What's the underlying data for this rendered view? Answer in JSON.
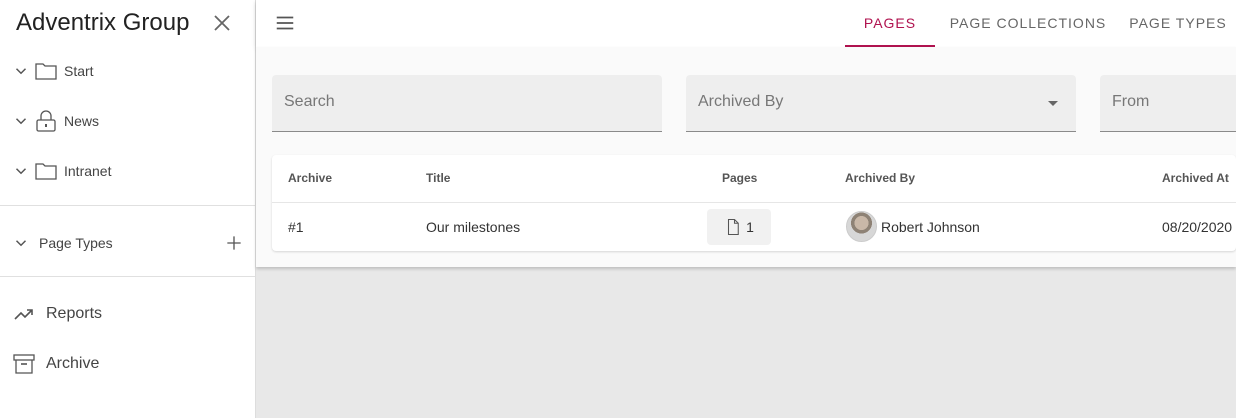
{
  "sidebar": {
    "brand": "Adventrix Group",
    "tree": [
      {
        "label": "Start",
        "icon": "folder-icon"
      },
      {
        "label": "News",
        "icon": "lock-icon"
      },
      {
        "label": "Intranet",
        "icon": "folder-icon"
      }
    ],
    "page_types_label": "Page Types",
    "nav": [
      {
        "label": "Reports",
        "icon": "trending-up-icon"
      },
      {
        "label": "Archive",
        "icon": "archive-box-icon"
      }
    ]
  },
  "topbar": {
    "tabs": [
      {
        "label": "PAGES",
        "active": true
      },
      {
        "label": "PAGE COLLECTIONS",
        "active": false
      },
      {
        "label": "PAGE TYPES",
        "active": false
      }
    ],
    "accent_color": "#b0124f"
  },
  "filters": {
    "search_placeholder": "Search",
    "archived_by_placeholder": "Archived By",
    "from_placeholder": "From"
  },
  "table": {
    "headers": {
      "archive": "Archive",
      "title": "Title",
      "pages": "Pages",
      "archived_by": "Archived By",
      "archived_at": "Archived At"
    },
    "rows": [
      {
        "archive": "#1",
        "title": "Our milestones",
        "pages": "1",
        "archived_by": "Robert Johnson",
        "archived_at": "08/20/2020"
      }
    ]
  }
}
